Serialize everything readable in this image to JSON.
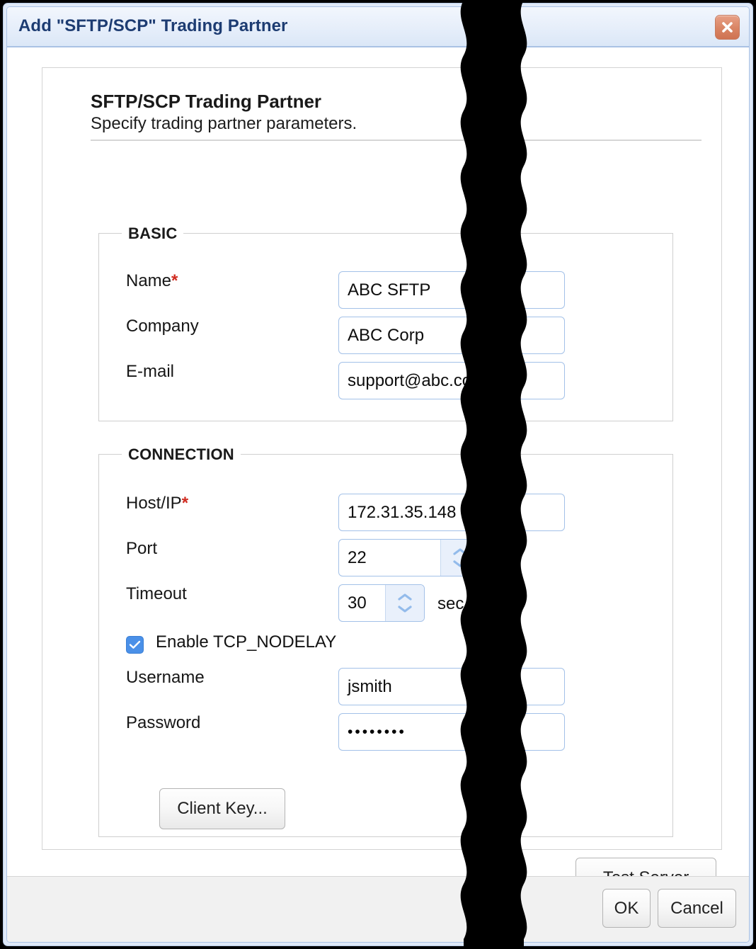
{
  "window": {
    "title": "Add \"SFTP/SCP\" Trading Partner",
    "close_icon": "close-icon",
    "accent_title_color": "#1d3c72",
    "close_button_color": "#d98464"
  },
  "panel": {
    "heading": "SFTP/SCP Trading Partner",
    "subheading": "Specify trading partner parameters."
  },
  "sections": {
    "basic": {
      "legend": "BASIC",
      "fields": [
        {
          "label": "Name",
          "required": true,
          "required_mark": "*",
          "value": "ABC SFTP",
          "type": "text"
        },
        {
          "label": "Company",
          "required": false,
          "required_mark": "",
          "value": "ABC Corp",
          "type": "text"
        },
        {
          "label": "E-mail",
          "required": false,
          "required_mark": "",
          "value": "support@abc.com",
          "type": "text"
        }
      ]
    },
    "connection": {
      "legend": "CONNECTION",
      "fields": [
        {
          "label": "Host/IP",
          "required": true,
          "required_mark": "*",
          "value": "172.31.35.148",
          "type": "text"
        },
        {
          "label": "Port",
          "required": false,
          "required_mark": "",
          "value": "22",
          "type": "spinner"
        },
        {
          "label": "Timeout",
          "required": false,
          "required_mark": "",
          "value": "30",
          "type": "spinner",
          "unit": "sec"
        },
        {
          "label": "Username",
          "required": false,
          "required_mark": "",
          "value": "jsmith",
          "type": "text"
        },
        {
          "label": "Password",
          "required": false,
          "required_mark": "",
          "value": "••••••••",
          "type": "password"
        }
      ],
      "checkbox": {
        "label": "Enable TCP_NODELAY",
        "checked": true,
        "check_color": "#4a90e8"
      },
      "client_key_button": "Client Key..."
    }
  },
  "actions": {
    "test_server": "Test Server",
    "ok": "OK",
    "cancel": "Cancel"
  },
  "icons": {
    "spinner_up": "chevron-up-icon",
    "spinner_down": "chevron-down-icon",
    "checkmark": "checkmark-icon"
  }
}
